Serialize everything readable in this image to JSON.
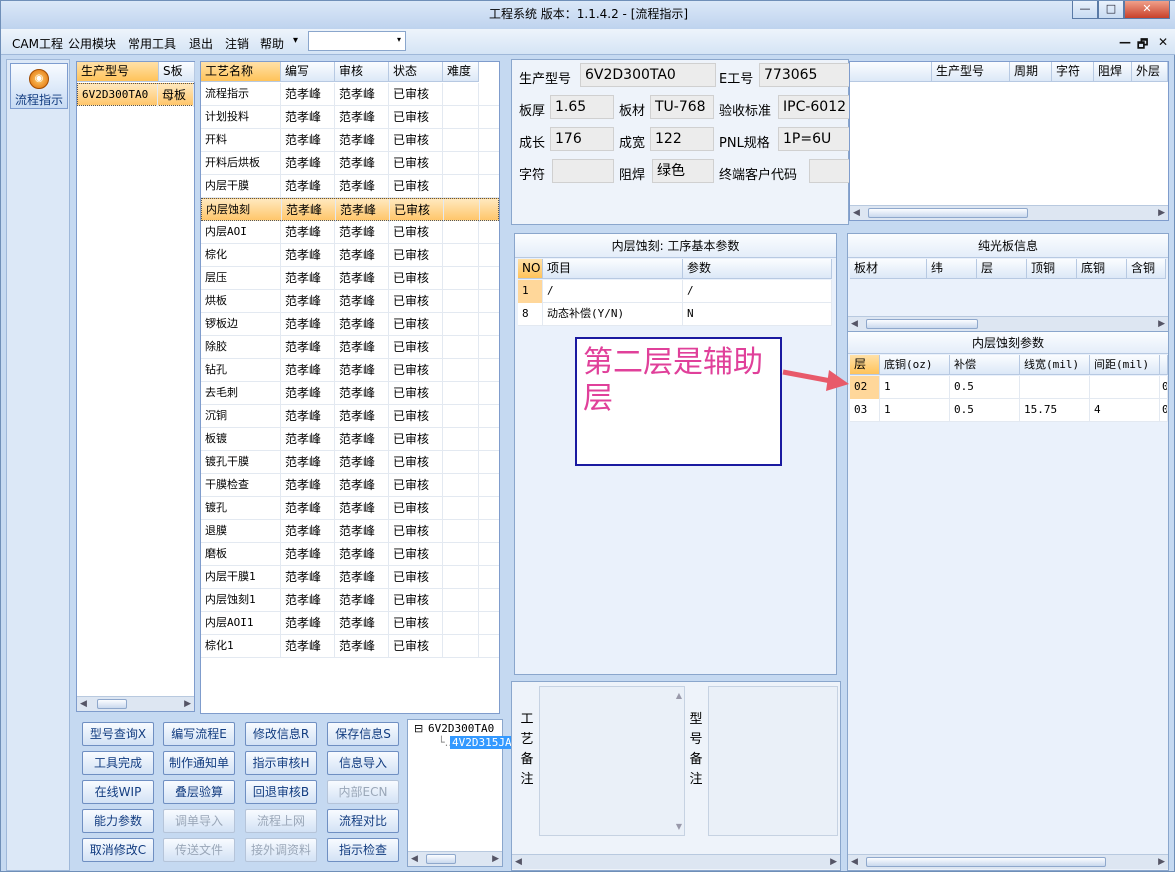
{
  "window": {
    "title": "工程系统   版本：1.1.4.2 - [流程指示]",
    "min": "—",
    "max": "□",
    "close": "✕"
  },
  "menu": {
    "items": [
      "CAM工程",
      "公用模块",
      "常用工具",
      "退出",
      "注销",
      "帮助"
    ],
    "help_arrow": "▾",
    "combo_arrow": "▾",
    "mdi": [
      "—",
      "🗗",
      "✕"
    ]
  },
  "toolbar": {
    "flow_label": "流程指示",
    "flow_icon": "process-icon"
  },
  "models": {
    "headers": [
      "生产型号",
      "S板"
    ],
    "rows": [
      [
        "6V2D300TA0",
        "母板"
      ]
    ]
  },
  "process": {
    "headers": [
      "工艺名称",
      "编写",
      "审核",
      "状态",
      "难度"
    ],
    "rows": [
      [
        "流程指示",
        "范孝峰",
        "范孝峰",
        "已审核"
      ],
      [
        "计划投料",
        "范孝峰",
        "范孝峰",
        "已审核"
      ],
      [
        "开料",
        "范孝峰",
        "范孝峰",
        "已审核"
      ],
      [
        "开料后烘板",
        "范孝峰",
        "范孝峰",
        "已审核"
      ],
      [
        "内层干膜",
        "范孝峰",
        "范孝峰",
        "已审核"
      ],
      [
        "内层蚀刻",
        "范孝峰",
        "范孝峰",
        "已审核"
      ],
      [
        "内层AOI",
        "范孝峰",
        "范孝峰",
        "已审核"
      ],
      [
        "棕化",
        "范孝峰",
        "范孝峰",
        "已审核"
      ],
      [
        "层压",
        "范孝峰",
        "范孝峰",
        "已审核"
      ],
      [
        "烘板",
        "范孝峰",
        "范孝峰",
        "已审核"
      ],
      [
        "锣板边",
        "范孝峰",
        "范孝峰",
        "已审核"
      ],
      [
        "除胶",
        "范孝峰",
        "范孝峰",
        "已审核"
      ],
      [
        "钻孔",
        "范孝峰",
        "范孝峰",
        "已审核"
      ],
      [
        "去毛刺",
        "范孝峰",
        "范孝峰",
        "已审核"
      ],
      [
        "沉铜",
        "范孝峰",
        "范孝峰",
        "已审核"
      ],
      [
        "板镀",
        "范孝峰",
        "范孝峰",
        "已审核"
      ],
      [
        "镀孔干膜",
        "范孝峰",
        "范孝峰",
        "已审核"
      ],
      [
        "干膜检查",
        "范孝峰",
        "范孝峰",
        "已审核"
      ],
      [
        "镀孔",
        "范孝峰",
        "范孝峰",
        "已审核"
      ],
      [
        "退膜",
        "范孝峰",
        "范孝峰",
        "已审核"
      ],
      [
        "磨板",
        "范孝峰",
        "范孝峰",
        "已审核"
      ],
      [
        "内层干膜1",
        "范孝峰",
        "范孝峰",
        "已审核"
      ],
      [
        "内层蚀刻1",
        "范孝峰",
        "范孝峰",
        "已审核"
      ],
      [
        "内层AOI1",
        "范孝峰",
        "范孝峰",
        "已审核"
      ],
      [
        "棕化1",
        "范孝峰",
        "范孝峰",
        "已审核"
      ]
    ]
  },
  "buttons": [
    [
      "型号查询X",
      "编写流程E",
      "修改信息R",
      "保存信息S"
    ],
    [
      "工具完成",
      "制作通知单",
      "指示审核H",
      "信息导入"
    ],
    [
      "在线WIP",
      "叠层验算",
      "回退审核B",
      "内部ECN"
    ],
    [
      "能力参数",
      "调单导入",
      "流程上网",
      "流程对比"
    ],
    [
      "取消修改C",
      "传送文件",
      "接外调资料",
      "指示检查"
    ]
  ],
  "disabled": [
    "内部ECN",
    "调单导入",
    "流程上网",
    "传送文件",
    "接外调资料"
  ],
  "tree": {
    "root": "6V2D300TA0",
    "child": "4V2D315JA"
  },
  "info": {
    "model_label": "生产型号",
    "model": "6V2D300TA0",
    "eno_label": "E工号",
    "eno": "773065",
    "thick_label": "板厚",
    "thick": "1.65",
    "mat_label": "板材",
    "mat": "TU-768",
    "std_label": "验收标准",
    "std": "IPC-6012",
    "len_label": "成长",
    "len": "176",
    "wid_label": "成宽",
    "wid": "122",
    "pnl_label": "PNL规格",
    "pnl": "1P=6U",
    "char_label": "字符",
    "char": "",
    "mask_label": "阻焊",
    "mask": "绿色",
    "cust_label": "终端客户代码",
    "cust": ""
  },
  "history": {
    "headers": [
      "生产型号",
      "周期",
      "字符",
      "阻焊",
      "外层"
    ]
  },
  "params": {
    "title": "内层蚀刻: 工序基本参数",
    "headers": [
      "NO",
      "项目",
      "参数"
    ],
    "rows": [
      [
        "1",
        "/",
        "/"
      ],
      [
        "8",
        "动态补偿(Y/N)",
        "N"
      ]
    ]
  },
  "bare": {
    "title": "纯光板信息",
    "headers": [
      "板材",
      "纬",
      "层",
      "顶铜",
      "底铜",
      "含铜"
    ]
  },
  "etch": {
    "title": "内层蚀刻参数",
    "headers": [
      "层",
      "底铜(oz)",
      "补偿",
      "线宽(mil)",
      "间距(mil)"
    ],
    "rows": [
      [
        "02",
        "1",
        "0.5",
        "",
        "",
        "0"
      ],
      [
        "03",
        "1",
        "0.5",
        "15.75",
        "4",
        "0"
      ]
    ]
  },
  "note": "第二层是辅助层",
  "memo": {
    "left_label": [
      "工",
      "艺",
      "备",
      "注"
    ],
    "right_label": [
      "型",
      "号",
      "备",
      "注"
    ]
  }
}
